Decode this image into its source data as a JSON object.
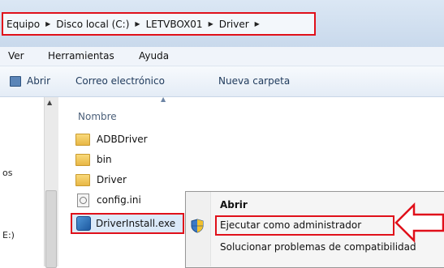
{
  "address_bar": {
    "crumbs": [
      "Equipo",
      "Disco local (C:)",
      "LETVBOX01",
      "Driver"
    ],
    "separator": "▶"
  },
  "menu_bar": {
    "items": [
      "Ver",
      "Herramientas",
      "Ayuda"
    ]
  },
  "toolbar": {
    "open_label": "Abrir",
    "email_label": "Correo electrónico",
    "new_folder_label": "Nueva carpeta"
  },
  "nav_pane": {
    "fragments": [
      "os",
      "E:)"
    ]
  },
  "file_list": {
    "column_header": "Nombre",
    "items": [
      {
        "name": "ADBDriver",
        "type": "folder"
      },
      {
        "name": "bin",
        "type": "folder"
      },
      {
        "name": "Driver",
        "type": "folder"
      },
      {
        "name": "config.ini",
        "type": "ini"
      },
      {
        "name": "DriverInstall.exe",
        "type": "exe",
        "selected": true
      }
    ]
  },
  "context_menu": {
    "open": "Abrir",
    "run_as_admin": "Ejecutar como administrador",
    "compat": "Solucionar problemas de compatibilidad"
  },
  "colors": {
    "highlight_red": "#e0101a",
    "window_blue": "#dbe7f4"
  }
}
